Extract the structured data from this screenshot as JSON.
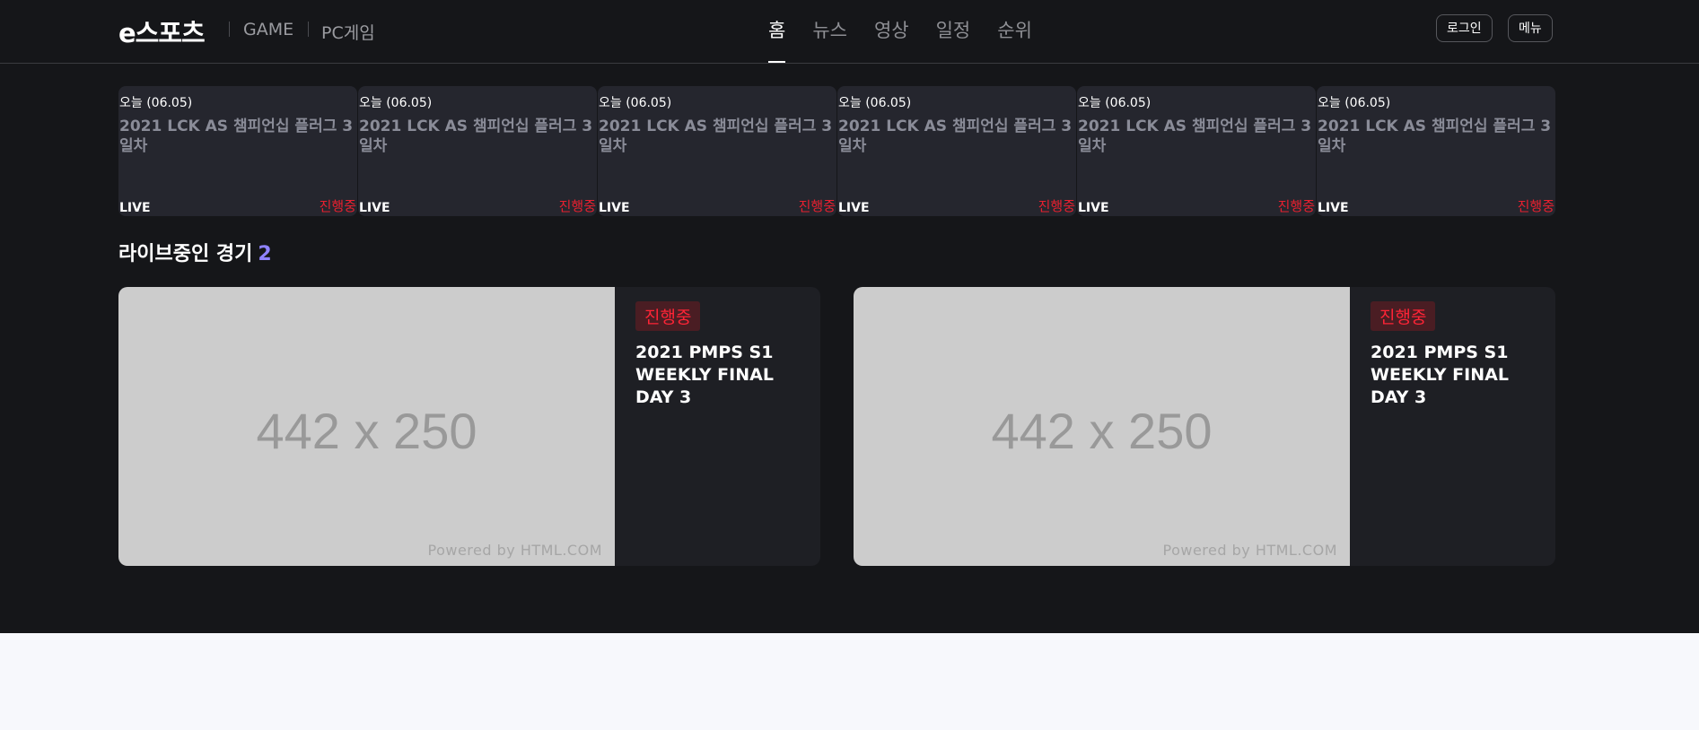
{
  "header": {
    "logo": "e스포츠",
    "links": [
      "GAME",
      "PC게임"
    ],
    "nav": [
      {
        "label": "홈",
        "active": true
      },
      {
        "label": "뉴스",
        "active": false
      },
      {
        "label": "영상",
        "active": false
      },
      {
        "label": "일정",
        "active": false
      },
      {
        "label": "순위",
        "active": false
      }
    ],
    "login_label": "로그인",
    "menu_label": "메뉴"
  },
  "schedule": [
    {
      "date": "오늘 (06.05)",
      "title": "2021 LCK AS 챔피언십 플러그 3일차",
      "live": "LIVE",
      "status": "진행중"
    },
    {
      "date": "오늘 (06.05)",
      "title": "2021 LCK AS 챔피언십 플러그 3일차",
      "live": "LIVE",
      "status": "진행중"
    },
    {
      "date": "오늘 (06.05)",
      "title": "2021 LCK AS 챔피언십 플러그 3일차",
      "live": "LIVE",
      "status": "진행중"
    },
    {
      "date": "오늘 (06.05)",
      "title": "2021 LCK AS 챔피언십 플러그 3일차",
      "live": "LIVE",
      "status": "진행중"
    },
    {
      "date": "오늘 (06.05)",
      "title": "2021 LCK AS 챔피언십 플러그 3일차",
      "live": "LIVE",
      "status": "진행중"
    },
    {
      "date": "오늘 (06.05)",
      "title": "2021 LCK AS 챔피언십 플러그 3일차",
      "live": "LIVE",
      "status": "진행중"
    }
  ],
  "live_section": {
    "title": "라이브중인 경기",
    "count": "2",
    "matches": [
      {
        "thumb_size": "442 x 250",
        "thumb_powered": "Powered by HTML.COM",
        "badge": "진행중",
        "title": "2021 PMPS S1 WEEKLY FINAL DAY 3"
      },
      {
        "thumb_size": "442 x 250",
        "thumb_powered": "Powered by HTML.COM",
        "badge": "진행중",
        "title": "2021 PMPS S1 WEEKLY FINAL DAY 3"
      }
    ]
  },
  "colors": {
    "background": "#151619",
    "card": "#25262e",
    "live_red": "#e8202f",
    "accent_purple": "#8f82ff",
    "footer": "#f7f8fc"
  }
}
